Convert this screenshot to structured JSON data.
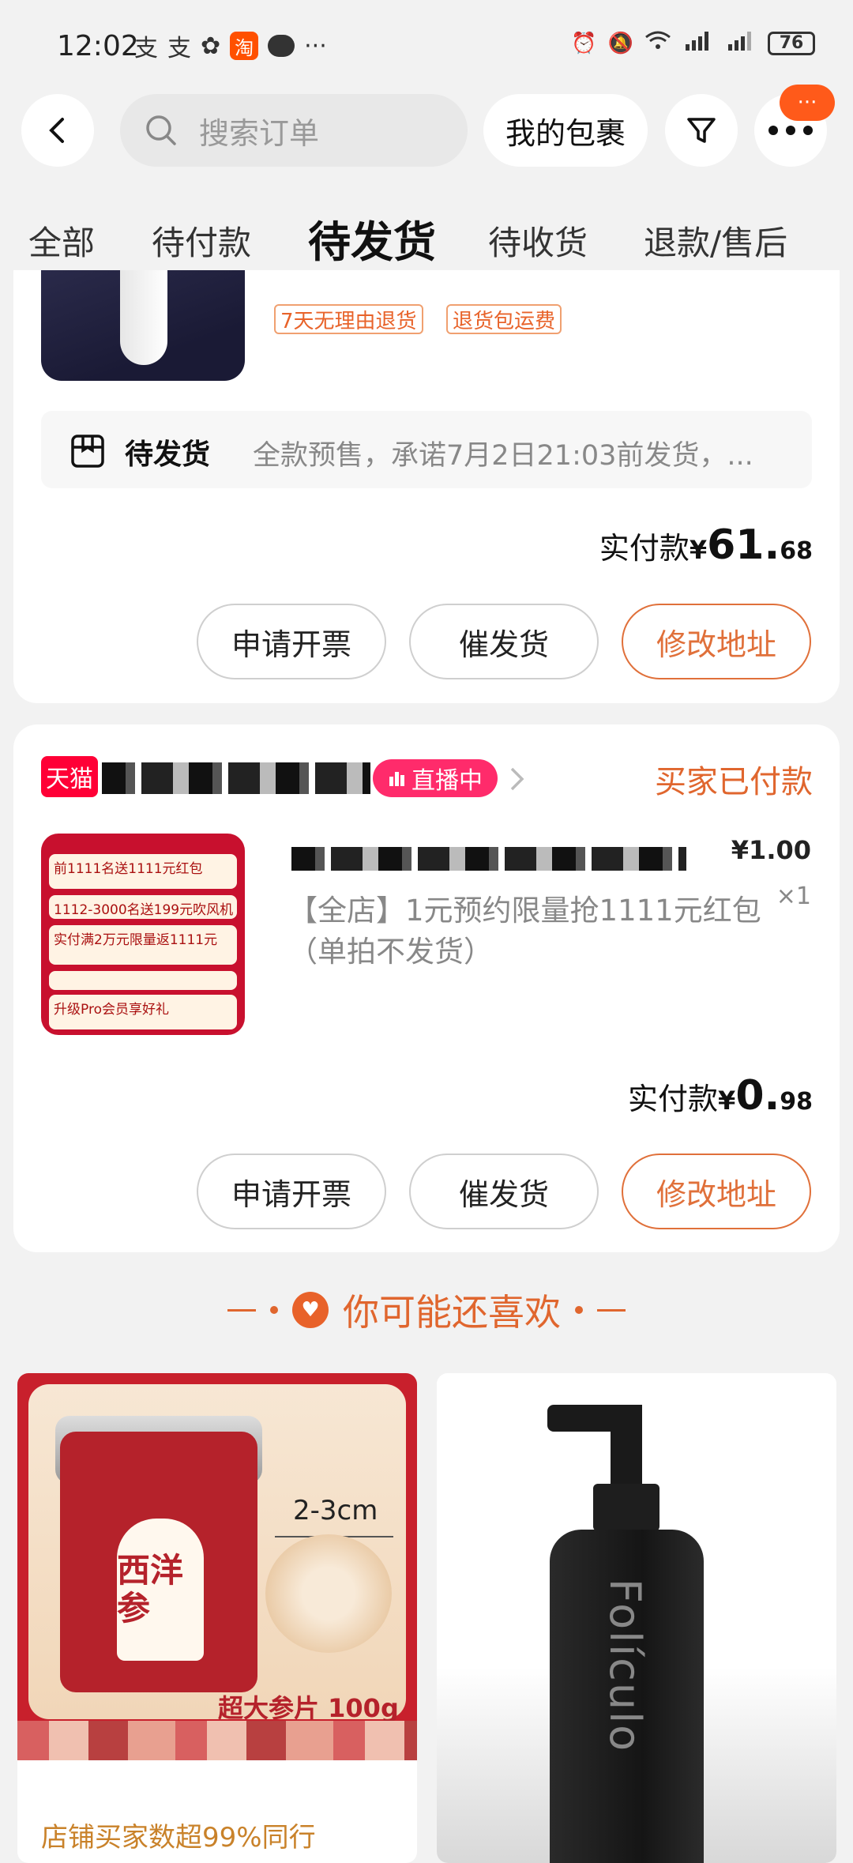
{
  "status_bar": {
    "time": "12:02",
    "battery": "76",
    "icons_left": [
      "alipay-icon",
      "alipay-icon",
      "photos-icon",
      "taobao-icon",
      "chat-icon",
      "more-dots"
    ],
    "icons_right": [
      "alarm-icon",
      "mute-icon",
      "wifi-icon",
      "signal-4g-icon",
      "signal-5g-icon",
      "battery-icon"
    ],
    "taobao_glyph": "淘",
    "more": "···"
  },
  "header": {
    "search_placeholder": "搜索订单",
    "my_packages": "我的包裹",
    "badge": "···"
  },
  "tabs": [
    {
      "label": "全部",
      "active": false
    },
    {
      "label": "待付款",
      "active": false
    },
    {
      "label": "待发货",
      "active": true
    },
    {
      "label": "待收货",
      "active": false
    },
    {
      "label": "退款/售后",
      "active": false
    }
  ],
  "order1": {
    "tags": [
      "7天无理由退货",
      "退货包运费"
    ],
    "shipping_title": "待发货",
    "shipping_desc": "全款预售，承诺7月2日21:03前发货，...",
    "paid_label": "实付款",
    "paid_currency": "¥",
    "paid_big": "61.",
    "paid_small": "68",
    "buttons": [
      "申请开票",
      "催发货",
      "修改地址"
    ]
  },
  "order2": {
    "store_logo": "天猫",
    "live_label": "直播中",
    "status": "买家已付款",
    "price": "¥1.00",
    "qty": "×1",
    "title": "【全店】1元预约限量抢1111元红包（单拍不发货）",
    "thumb_lines": [
      "前1111名送1111元红包",
      "1112-3000名送199元吹风机",
      "实付满2万元限量返1111元",
      "",
      "升级Pro会员享好礼"
    ],
    "paid_label": "实付款",
    "paid_currency": "¥",
    "paid_big": "0.",
    "paid_small": "98",
    "buttons": [
      "申请开票",
      "催发货",
      "修改地址"
    ]
  },
  "recommend": {
    "title": "你可能还喜欢",
    "item1": {
      "jar_text": "西洋参",
      "size_label": "2-3cm",
      "caption": "超大参片 100g",
      "shop_note": "店铺买家数超99%同行"
    },
    "item2": {
      "brand": "Folículo"
    }
  },
  "colors": {
    "accent": "#e0662e",
    "tmall_red": "#ff0036",
    "live_pink": "#ff2b6b",
    "background": "#f2f2f2"
  }
}
